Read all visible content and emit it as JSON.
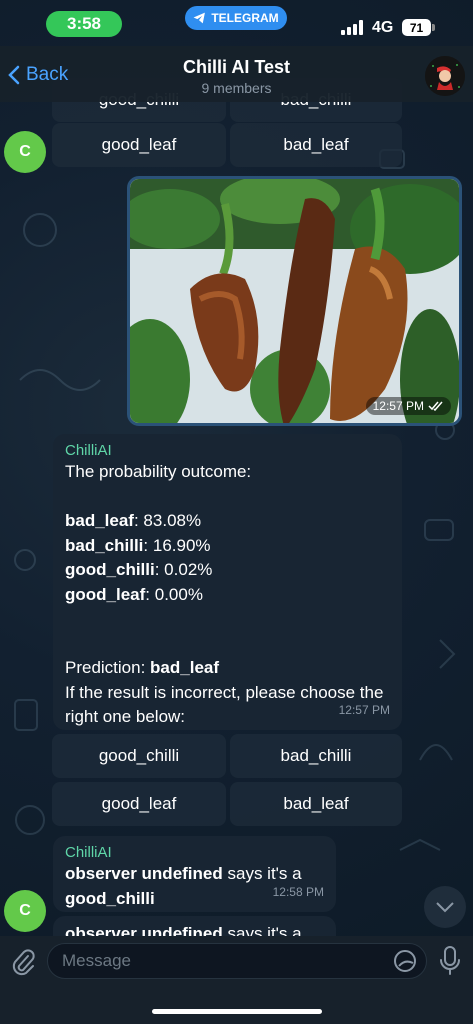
{
  "status_bar": {
    "time": "3:58",
    "pill_label": "TELEGRAM",
    "network": "4G",
    "battery": "71"
  },
  "header": {
    "back_label": "Back",
    "title": "Chilli AI Test",
    "subtitle": "9 members"
  },
  "keyboard_top": {
    "row_partial": [
      "good_chilli",
      "bad_chilli"
    ],
    "row_last": [
      "good_leaf",
      "bad_leaf"
    ]
  },
  "sender_avatar_letter": "C",
  "photo": {
    "time": "12:57 PM"
  },
  "result_message": {
    "sender": "ChilliAI",
    "intro": "The probability outcome:",
    "probabilities": [
      {
        "label": "bad_leaf",
        "value": ": 83.08%"
      },
      {
        "label": "bad_chilli",
        "value": ": 16.90%"
      },
      {
        "label": "good_chilli",
        "value": ": 0.02%"
      },
      {
        "label": "good_leaf",
        "value": ": 0.00%"
      }
    ],
    "prediction_prefix": "Prediction: ",
    "prediction_value": "bad_leaf",
    "footer": "If the result is incorrect, please choose the right one below:",
    "time": "12:57 PM"
  },
  "keyboard": {
    "rows": [
      [
        "good_chilli",
        "bad_chilli"
      ],
      [
        "good_leaf",
        "bad_leaf"
      ]
    ]
  },
  "reply_message": {
    "sender": "ChilliAI",
    "user": "observer undefined",
    "says": " says it's a",
    "choice": "good_chilli",
    "time": "12:58 PM"
  },
  "partial_message": {
    "user": "observer undefined",
    "says": " says it's a"
  },
  "input": {
    "placeholder": "Message"
  },
  "colors": {
    "accent": "#4aa3ff",
    "bubble": "#182533",
    "sender_name": "#5fd6a8",
    "avatar": "#63c94a"
  }
}
